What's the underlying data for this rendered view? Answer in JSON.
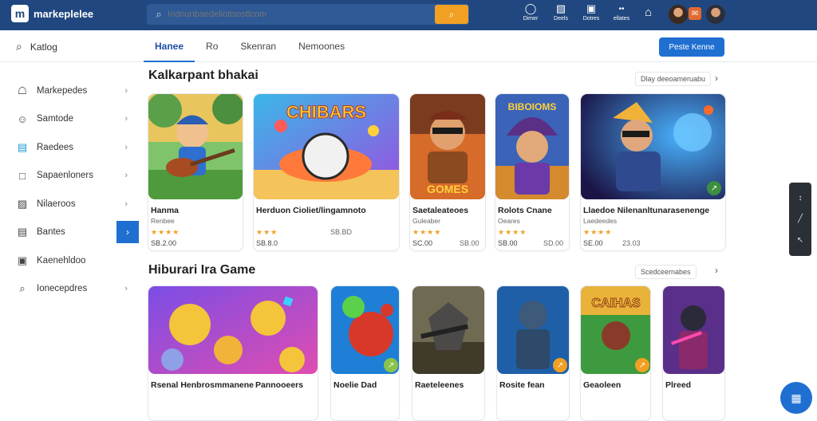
{
  "header": {
    "logo_text": "markeplelee",
    "logo_mark": "m",
    "search_placeholder": "Indnunbaedeliotisostlcom",
    "icons": [
      {
        "name": "dimer-icon",
        "label": "Dimer"
      },
      {
        "name": "deels-icon",
        "label": "Deels"
      },
      {
        "name": "dotres-icon",
        "label": "Dotres"
      },
      {
        "name": "exlates-icon",
        "label": "ellates"
      }
    ]
  },
  "subbar": {
    "catalog_label": "Katlog",
    "tabs": [
      "Hanee",
      "Ro",
      "Skenran",
      "Nemoones"
    ],
    "publish_button": "Peste Kenne"
  },
  "sidebar": {
    "items": [
      {
        "label": "Markepedes",
        "icon": "store-icon",
        "chevron": true
      },
      {
        "label": "Samtode",
        "icon": "user-icon",
        "chevron": true
      },
      {
        "label": "Raedees",
        "icon": "folder-icon",
        "chevron": true
      },
      {
        "label": "Sapaenloners",
        "icon": "square-icon",
        "chevron": true
      },
      {
        "label": "Nilaeroos",
        "icon": "map-icon",
        "chevron": true
      },
      {
        "label": "Bantes",
        "icon": "list-icon",
        "chevron": "active"
      },
      {
        "label": "Kaenehldoo",
        "icon": "briefcase-icon",
        "chevron": false
      },
      {
        "label": "Ionecepdres",
        "icon": "search-icon",
        "chevron": true
      }
    ]
  },
  "section1": {
    "title": "Kalkarpant bhakai",
    "link": "Dlay deeoameruabu"
  },
  "section2": {
    "title": "Hiburari Ira Game",
    "link": "Scedceernabes"
  },
  "row1": [
    {
      "title": "Hanma",
      "pub": "Renbee",
      "stars": "★★★★",
      "price": "SB.2.00",
      "dl": "",
      "art_name": "guitar-boy-art"
    },
    {
      "title": "Herduon Cioliet/lingamnoto",
      "pub": "",
      "stars": "★★★",
      "price": "SB.8.0",
      "dl": "SB.BD",
      "art_name": "chibars-ball-art",
      "art_text": "CHIBARS"
    },
    {
      "title": "Saetaleateoes",
      "pub": "Guleaber",
      "stars": "★★★★",
      "price": "SC.00",
      "dl": "SB.00",
      "art_name": "pirate-art",
      "art_text": "GOMES"
    },
    {
      "title": "Rolots Cnane",
      "pub": "Oeares",
      "stars": "★★★★",
      "price": "SB.00",
      "dl": "SD.00",
      "art_name": "wizard-art",
      "art_text": "BIBOIOMS"
    },
    {
      "title": "Llaedoe Nilenanltunarasenenge",
      "pub": "Laedeedes",
      "stars": "★★★★",
      "price": "SE.00",
      "dl": "23.03",
      "art_name": "space-hero-art"
    }
  ],
  "row2": [
    {
      "title": "Rsenal Henbrosmmanene",
      "pub": "",
      "art_name": "bears-art"
    },
    {
      "title": "Pannooeers",
      "pub": "",
      "art_name": "red-bear-art"
    },
    {
      "title": "Noelie Dad",
      "pub": "",
      "art_name": "wolf-art"
    },
    {
      "title": "Raeteleenes",
      "pub": "",
      "art_name": "soldier-art"
    },
    {
      "title": "Rosite fean",
      "pub": "",
      "art_name": "knight-art"
    },
    {
      "title": "Geaoleen",
      "pub": "",
      "art_name": "caihas-art",
      "art_text": "CAIHAS"
    },
    {
      "title": "Plreed",
      "pub": "",
      "art_name": "ninja-art"
    }
  ],
  "colors": {
    "brand": "#20477f",
    "accent": "#1f6fd1",
    "star": "#f2a023"
  }
}
